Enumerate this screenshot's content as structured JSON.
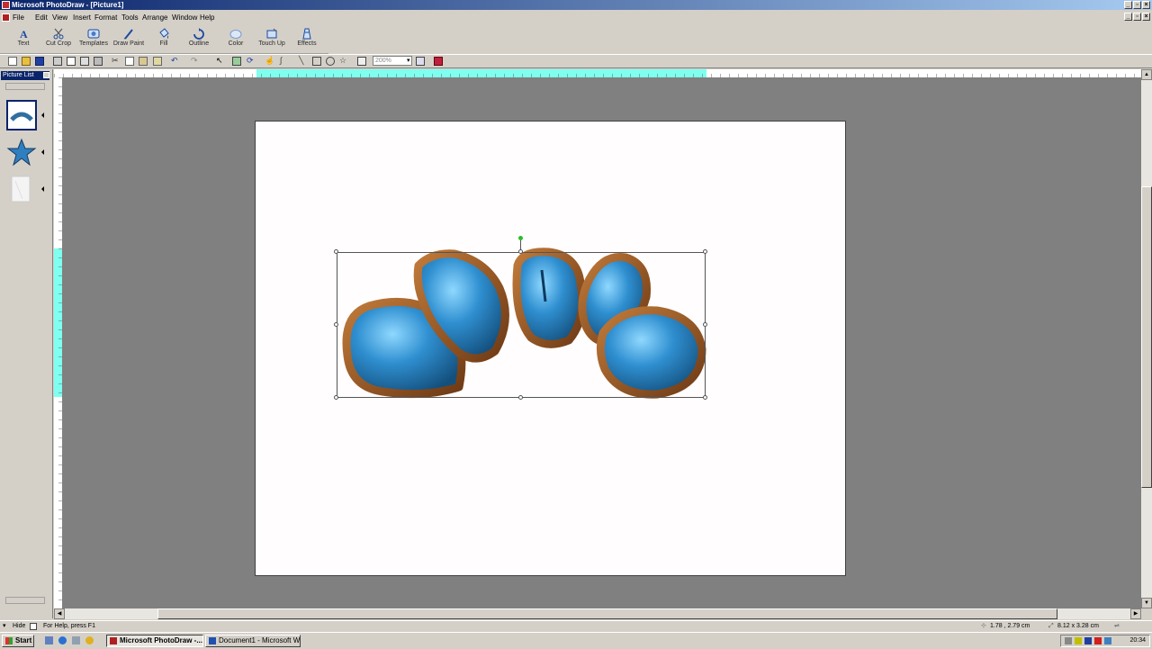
{
  "window": {
    "title": "Microsoft PhotoDraw - [Picture1]"
  },
  "menu": [
    "File",
    "Edit",
    "View",
    "Insert",
    "Format",
    "Tools",
    "Arrange",
    "Window",
    "Help"
  ],
  "big_toolbar": [
    {
      "label": "Text",
      "icon": "text-icon"
    },
    {
      "label": "Cut Crop",
      "icon": "scissors-icon"
    },
    {
      "label": "Templates",
      "icon": "templates-icon"
    },
    {
      "label": "Draw Paint",
      "icon": "brush-icon"
    },
    {
      "label": "Fill",
      "icon": "fill-bucket-icon"
    },
    {
      "label": "Outline",
      "icon": "outline-icon"
    },
    {
      "label": "Color",
      "icon": "color-icon"
    },
    {
      "label": "Touch Up",
      "icon": "touch-up-icon"
    },
    {
      "label": "Effects",
      "icon": "effects-icon"
    }
  ],
  "zoom": {
    "value": "200%"
  },
  "picture_list": {
    "title": "Picture List"
  },
  "status": {
    "hide_label": "Hide",
    "help": "For Help, press F1",
    "position": "1.78 , 2.79 cm",
    "size": "8.12 x 3.28 cm"
  },
  "taskbar": {
    "start": "Start",
    "buttons": [
      {
        "label": "Microsoft PhotoDraw -..."
      },
      {
        "label": "Document1 - Microsoft W..."
      }
    ],
    "clock": "20:34"
  },
  "colors": {
    "title_start": "#0a246a",
    "title_end": "#a6caf0",
    "workspace": "#808080",
    "stone_blue": "#2f8fd0",
    "stone_border": "#a0602a"
  }
}
